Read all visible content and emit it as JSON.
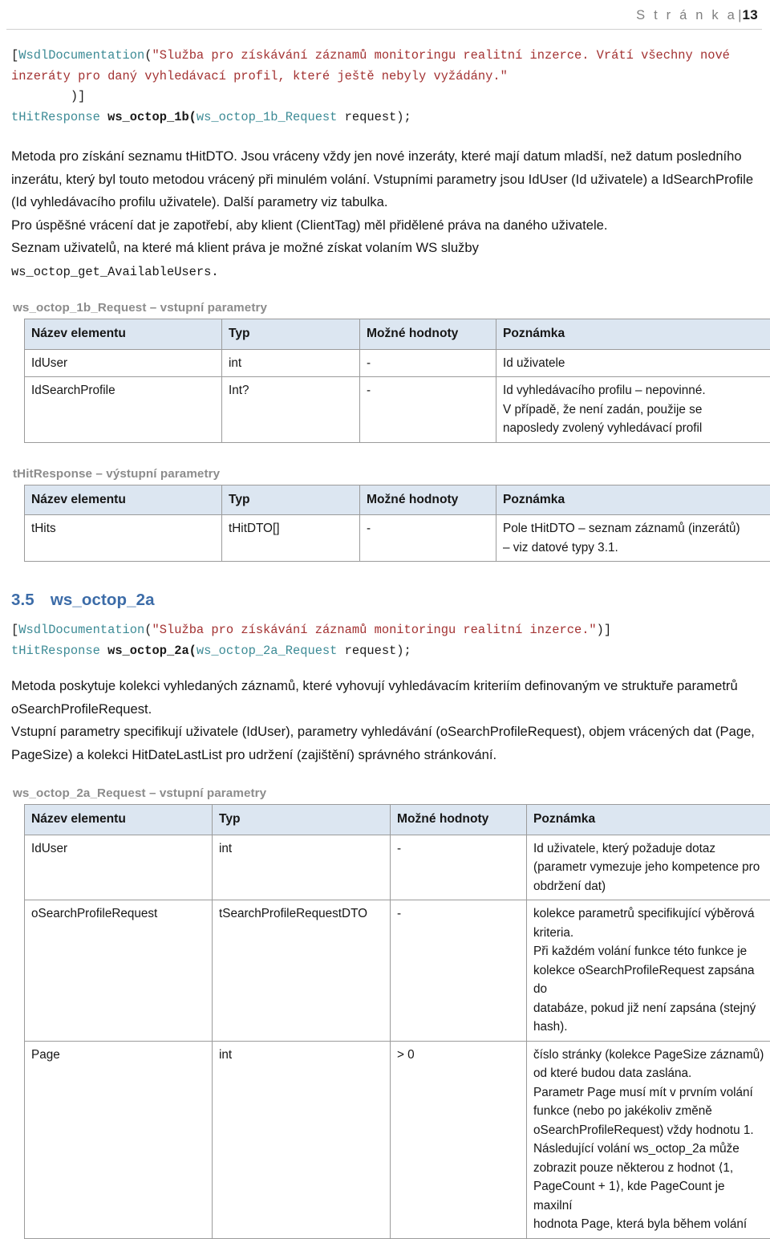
{
  "header": {
    "label": "S t r á n k a",
    "separator": "|",
    "page_number": "13"
  },
  "code_block_1": {
    "line1_open": "[",
    "line1_attr": "WsdlDocumentation",
    "line1_paren": "(",
    "line1_string": "\"Služba pro získávání záznamů monitoringu realitní inzerce. Vrátí všechny nové inzeráty pro daný vyhledávací profil, které ještě nebyly vyžádány.\"",
    "line2_close": "        )]",
    "line3_return_type": "tHitResponse",
    "line3_method": " ws_octop_1b(",
    "line3_param_type": "ws_octop_1b_Request",
    "line3_tail": " request);"
  },
  "paragraphs_1": [
    "Metoda pro získání seznamu tHitDTO. Jsou vráceny vždy jen nové inzeráty, které mají datum mladší, než datum posledního inzerátu, který byl touto metodou vrácený při minulém volání. Vstupními parametry jsou IdUser (Id uživatele) a IdSearchProfile (Id vyhledávacího profilu uživatele). Další parametry viz tabulka.",
    "Pro úspěšné vrácení dat je zapotřebí, aby klient (ClientTag) měl přidělené práva na daného uživatele.",
    "Seznam uživatelů, na které má klient práva je možné získat volaním WS služby"
  ],
  "paragraph_1_mono_tail": "ws_octop_get_AvailableUsers.",
  "table_1": {
    "caption": "ws_octop_1b_Request – vstupní parametry",
    "columns": [
      "Název elementu",
      "Typ",
      "Možné hodnoty",
      "Poznámka"
    ],
    "rows": [
      {
        "name": "IdUser",
        "type": "int",
        "values": "-",
        "note_lines": [
          "Id uživatele"
        ]
      },
      {
        "name": "IdSearchProfile",
        "type": "Int?",
        "values": "-",
        "note_lines": [
          "Id vyhledávacího profilu – nepovinné.",
          "V případě, že není zadán, použije se",
          "naposledy zvolený vyhledávací profil"
        ]
      }
    ]
  },
  "table_2": {
    "caption": "tHitResponse – výstupní parametry",
    "columns": [
      "Název elementu",
      "Typ",
      "Možné hodnoty",
      "Poznámka"
    ],
    "rows": [
      {
        "name": "tHits",
        "type": "tHitDTO[]",
        "values": "-",
        "note_lines": [
          "Pole tHitDTO – seznam záznamů (inzerátů)",
          "– viz datové typy 3.1."
        ]
      }
    ]
  },
  "section_3_5": {
    "number": "3.5",
    "title": "ws_octop_2a"
  },
  "code_block_2": {
    "line1_open": "[",
    "line1_attr": "WsdlDocumentation",
    "line1_paren": "(",
    "line1_string": "\"Služba pro získávání záznamů monitoringu realitní inzerce.\"",
    "line1_close": ")]",
    "line2_return_type": "tHitResponse",
    "line2_method": " ws_octop_2a(",
    "line2_param_type": "ws_octop_2a_Request",
    "line2_tail": " request);"
  },
  "paragraphs_2": [
    "Metoda poskytuje kolekci vyhledaných záznamů, které vyhovují vyhledávacím kriteriím definovaným ve struktuře parametrů oSearchProfileRequest.",
    "Vstupní parametry specifikují uživatele (IdUser), parametry vyhledávání (oSearchProfileRequest), objem vrácených dat (Page, PageSize) a kolekci HitDateLastList pro udržení (zajištění) správného stránkování."
  ],
  "table_3": {
    "caption": "ws_octop_2a_Request – vstupní parametry",
    "columns": [
      "Název elementu",
      "Typ",
      "Možné hodnoty",
      "Poznámka"
    ],
    "rows": [
      {
        "name": "IdUser",
        "type": "int",
        "values": "-",
        "note_lines": [
          "Id uživatele, který požaduje dotaz",
          "(parametr vymezuje jeho kompetence pro",
          "obdržení dat)"
        ]
      },
      {
        "name": "oSearchProfileRequest",
        "type": "tSearchProfileRequestDTO",
        "values": "-",
        "note_lines": [
          "kolekce parametrů specifikující výběrová",
          "kriteria.",
          "Při každém volání funkce této funkce je",
          "kolekce oSearchProfileRequest zapsána do",
          "databáze, pokud již není zapsána (stejný",
          "hash)."
        ]
      },
      {
        "name": "Page",
        "type": "int",
        "values": "> 0",
        "note_lines": [
          "číslo stránky (kolekce PageSize záznamů)",
          "od které budou data zaslána.",
          "Parametr Page musí mít v prvním volání",
          "funkce (nebo po jakékoliv změně",
          "oSearchProfileRequest) vždy hodnotu 1.",
          "Následující volání ws_octop_2a může",
          "zobrazit pouze některou z hodnot ⟨1,",
          "PageCount + 1⟩, kde PageCount je maxilní",
          "hodnota Page, která byla během volání"
        ]
      }
    ]
  },
  "colors": {
    "heading_blue": "#3c6ca8",
    "table_header_bg": "#dce6f1",
    "caption_gray": "#8c8c8c",
    "code_type_teal": "#3d8b96",
    "code_string_red": "#a33232",
    "table_border": "#9b9b9b"
  }
}
